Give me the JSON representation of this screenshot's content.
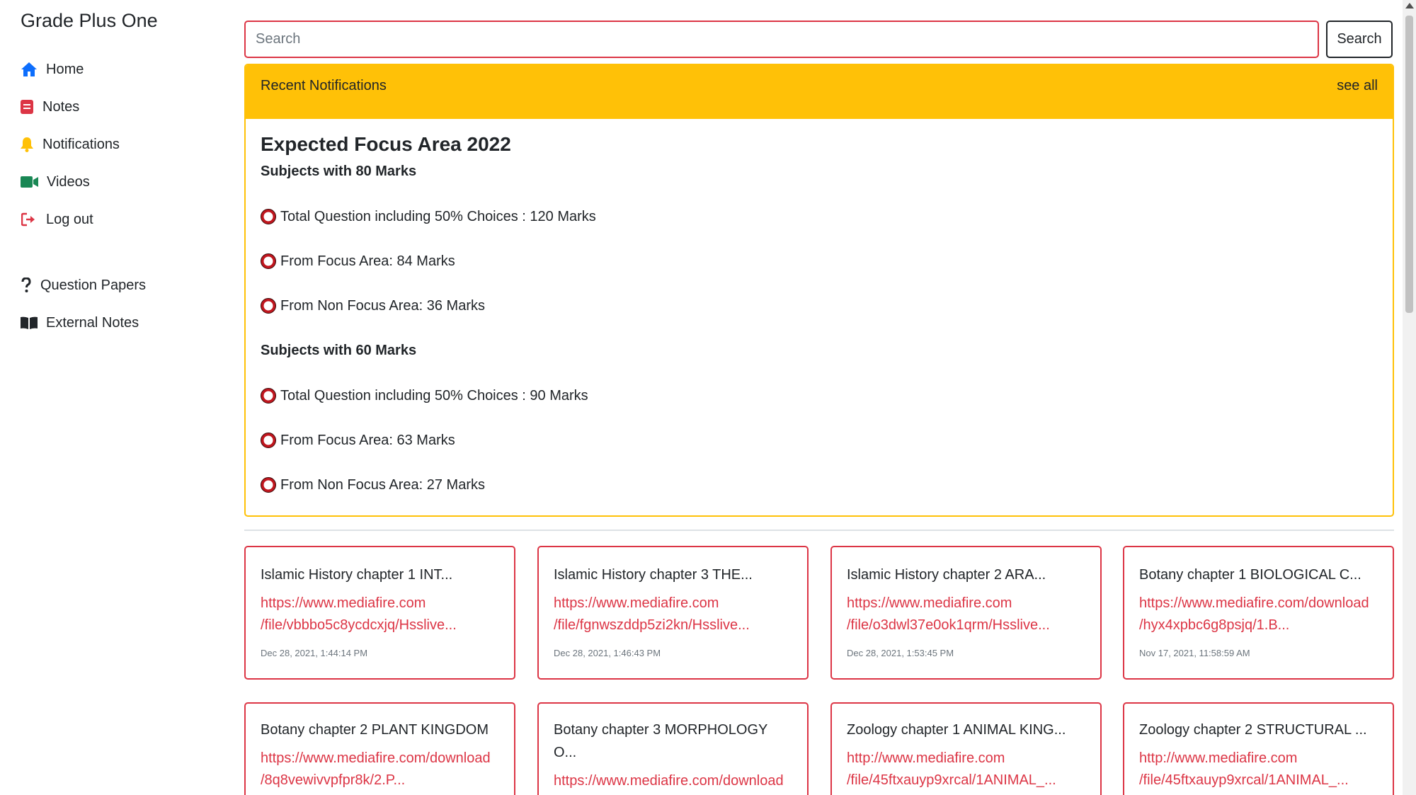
{
  "brand": "Grade Plus One",
  "sidebar": {
    "items": [
      {
        "label": "Home",
        "icon": "home-icon",
        "color": "#0d6efd"
      },
      {
        "label": "Notes",
        "icon": "notes-icon",
        "color": "#dc3545"
      },
      {
        "label": "Notifications",
        "icon": "bell-icon",
        "color": "#ffc107"
      },
      {
        "label": "Videos",
        "icon": "video-icon",
        "color": "#198754"
      },
      {
        "label": "Log out",
        "icon": "logout-icon",
        "color": "#dc3545"
      }
    ],
    "extra_items": [
      {
        "label": "Question Papers",
        "icon": "question-icon",
        "color": "#212529"
      },
      {
        "label": "External Notes",
        "icon": "book-icon",
        "color": "#212529"
      }
    ]
  },
  "search": {
    "placeholder": "Search",
    "value": "",
    "button_label": "Search"
  },
  "notifications": {
    "header": "Recent Notifications",
    "see_all": "see all",
    "title": "Expected Focus Area 2022",
    "sections": [
      {
        "heading": "Subjects with 80 Marks",
        "bullets": [
          "Total Question including 50% Choices : 120 Marks",
          "From Focus Area: 84 Marks",
          "From Non Focus Area: 36 Marks"
        ]
      },
      {
        "heading": "Subjects with 60 Marks",
        "bullets": [
          "Total Question including 50% Choices : 90 Marks",
          "From Focus Area: 63 Marks",
          "From Non Focus Area: 27 Marks"
        ]
      }
    ]
  },
  "cards": [
    {
      "title": "Islamic History chapter 1 INT...",
      "link_line1": "https://www.mediafire.com",
      "link_line2": "/file/vbbbo5c8ycdcxjq/Hsslive...",
      "time": "Dec 28, 2021, 1:44:14 PM"
    },
    {
      "title": "Islamic History chapter 3 THE...",
      "link_line1": "https://www.mediafire.com",
      "link_line2": "/file/fgnwszddp5zi2kn/Hsslive...",
      "time": "Dec 28, 2021, 1:46:43 PM"
    },
    {
      "title": "Islamic History chapter 2 ARA...",
      "link_line1": "https://www.mediafire.com",
      "link_line2": "/file/o3dwl37e0ok1qrm/Hsslive...",
      "time": "Dec 28, 2021, 1:53:45 PM"
    },
    {
      "title": "Botany chapter 1 BIOLOGICAL C...",
      "link_line1": "https://www.mediafire.com/download",
      "link_line2": "/hyx4xpbc6g8psjq/1.B...",
      "time": "Nov 17, 2021, 11:58:59 AM"
    },
    {
      "title": "Botany chapter 2 PLANT KINGDOM",
      "link_line1": "https://www.mediafire.com/download",
      "link_line2": "/8q8vewivvpfpr8k/2.P...",
      "time": ""
    },
    {
      "title": "Botany chapter 3 MORPHOLOGY O...",
      "link_line1": "https://www.mediafire.com/download",
      "link_line2": "",
      "time": ""
    },
    {
      "title": "Zoology chapter 1 ANIMAL KING...",
      "link_line1": "http://www.mediafire.com",
      "link_line2": "/file/45ftxauyp9xrcal/1ANIMAL_...",
      "time": ""
    },
    {
      "title": "Zoology chapter 2 STRUCTURAL ...",
      "link_line1": "http://www.mediafire.com",
      "link_line2": "/file/45ftxauyp9xrcal/1ANIMAL_...",
      "time": ""
    }
  ],
  "colors": {
    "accent_red": "#dc3545",
    "notification_yellow": "#ffc107",
    "home_blue": "#0d6efd",
    "video_green": "#198754"
  }
}
